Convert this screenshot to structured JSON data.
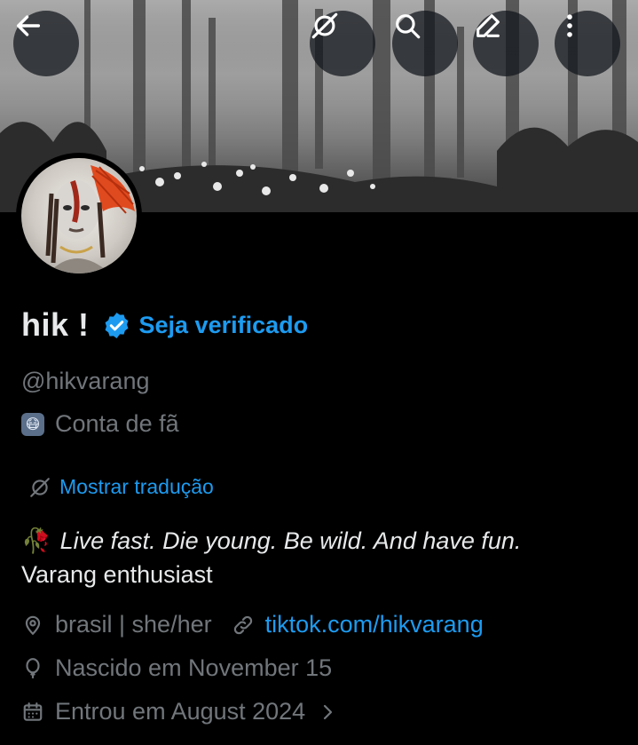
{
  "header": {
    "back_icon": "arrow-left-icon",
    "translate_icon": "translate-off-icon",
    "search_icon": "search-icon",
    "edit_icon": "pencil-icon",
    "more_icon": "more-vertical-icon"
  },
  "profile": {
    "name": "hik !",
    "verify_cta": "Seja verificado",
    "handle": "@hikvarang",
    "label_emoji": "😷",
    "label": "Conta de fã",
    "translate_link": "Mostrar tradução",
    "bio_emoji": "🥀",
    "bio_line1": "Live fast. Die young. Be wild. And have fun.",
    "bio_line2": "Varang enthusiast",
    "location": "brasil | she/her",
    "website": "tiktok.com/hikvarang",
    "birthday": "Nascido em November 15",
    "joined": "Entrou em August 2024"
  },
  "colors": {
    "accent": "#1d9bf0",
    "background": "#000000",
    "text_primary": "#e7e9ea",
    "text_secondary": "#71767b"
  }
}
